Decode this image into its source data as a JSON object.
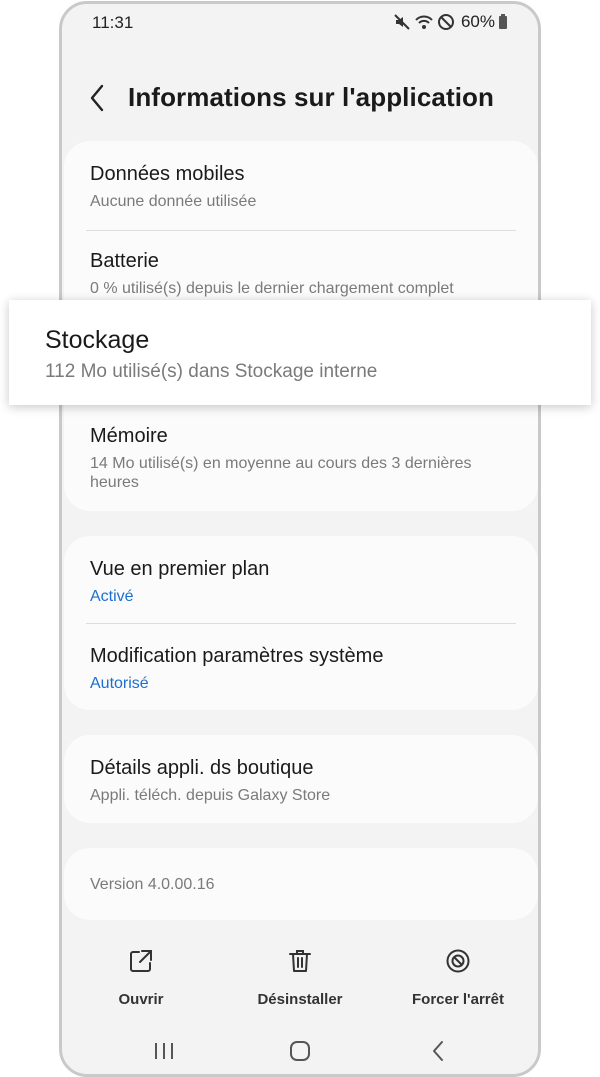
{
  "status": {
    "time": "11:31",
    "battery_percent": "60%",
    "icons": [
      "mute-icon",
      "wifi-icon",
      "dnd-icon",
      "battery-icon"
    ]
  },
  "header": {
    "title": "Informations sur l'application"
  },
  "sections": {
    "usage": {
      "mobile_data": {
        "title": "Données mobiles",
        "subtitle": "Aucune donnée utilisée"
      },
      "battery": {
        "title": "Batterie",
        "subtitle": "0 % utilisé(s) depuis le dernier chargement complet"
      },
      "memory": {
        "title": "Mémoire",
        "subtitle": "14 Mo utilisé(s) en moyenne au cours des 3 dernières heures"
      }
    },
    "permissions": {
      "overlay": {
        "title": "Vue en premier plan",
        "status": "Activé"
      },
      "system_settings": {
        "title": "Modification paramètres système",
        "status": "Autorisé"
      }
    },
    "store": {
      "title": "Détails appli. ds boutique",
      "subtitle": "Appli. téléch. depuis Galaxy Store"
    },
    "version": "Version 4.0.00.16"
  },
  "highlight": {
    "title": "Stockage",
    "subtitle": "112 Mo utilisé(s) dans Stockage interne"
  },
  "actions": {
    "open": "Ouvrir",
    "uninstall": "Désinstaller",
    "force_stop": "Forcer l'arrêt"
  },
  "colors": {
    "accent_blue": "#1b6fd1",
    "background": "#f3f3f3",
    "card": "#fbfbfb"
  }
}
